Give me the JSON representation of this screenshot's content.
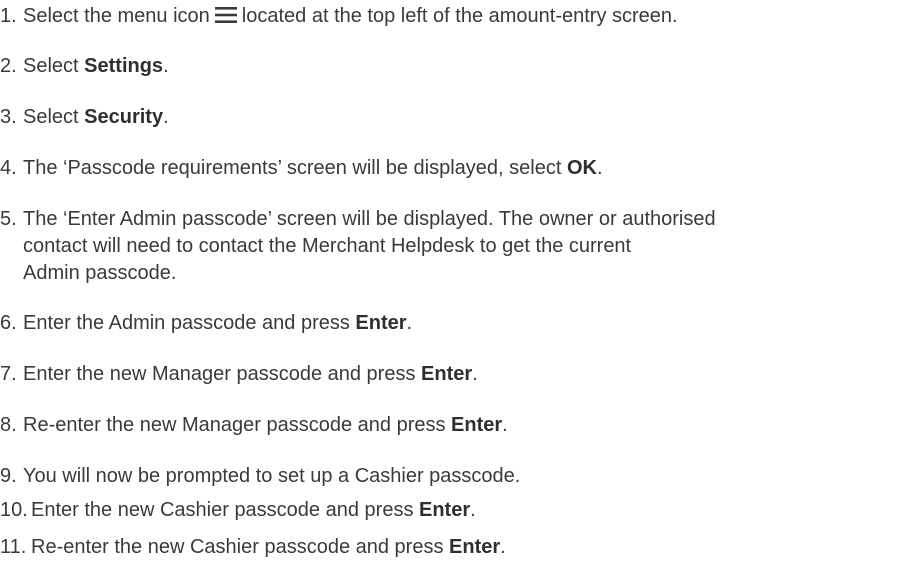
{
  "steps": [
    {
      "number": "1.",
      "pre": "Select the menu icon",
      "post": "located at the top left of the amount-entry screen.",
      "icon": "hamburger-menu-icon"
    },
    {
      "number": "2.",
      "pre": "Select ",
      "bold": "Settings",
      "post": "."
    },
    {
      "number": "3.",
      "pre": "Select ",
      "bold": "Security",
      "post": "."
    },
    {
      "number": "4.",
      "pre": "The ‘Passcode requirements’ screen will be displayed, select ",
      "bold": "OK",
      "post": "."
    },
    {
      "number": "5.",
      "lines": [
        "The ‘Enter Admin passcode’ screen will be displayed. The owner or authorised",
        "contact will need to contact the Merchant Helpdesk to get the current",
        "Admin passcode."
      ]
    },
    {
      "number": "6.",
      "pre": "Enter the Admin passcode and press ",
      "bold": "Enter",
      "post": "."
    },
    {
      "number": "7.",
      "pre": "Enter the new Manager passcode and press ",
      "bold": "Enter",
      "post": "."
    },
    {
      "number": "8.",
      "pre": "Re-enter the new Manager passcode and press ",
      "bold": "Enter",
      "post": "."
    },
    {
      "number": "9.",
      "pre": "You will now be prompted to set up a Cashier passcode."
    },
    {
      "number": "10.",
      "pre": "Enter the new Cashier passcode and press ",
      "bold": "Enter",
      "post": "."
    },
    {
      "number": "11.",
      "pre": "Re-enter the new Cashier passcode and press ",
      "bold": "Enter",
      "post": "."
    }
  ]
}
